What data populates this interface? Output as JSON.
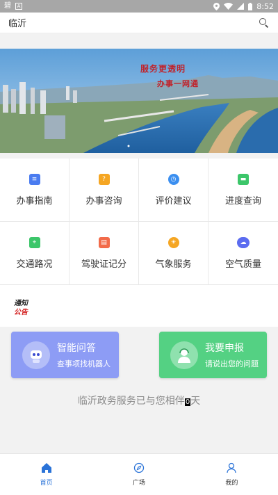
{
  "status_bar": {
    "carrier_icon": "碧",
    "time": "8:52",
    "icons": [
      "location-icon",
      "wifi-icon",
      "signal-icon",
      "battery-icon"
    ]
  },
  "header": {
    "title": "临沂",
    "search_icon": "search-icon"
  },
  "banner": {
    "slogan_line1": "服务更透明",
    "slogan_line2": "办事一网通"
  },
  "services": [
    {
      "label": "办事指南",
      "icon": "guide-icon",
      "color": "#4a7cf0"
    },
    {
      "label": "办事咨询",
      "icon": "consult-icon",
      "color": "#f5a623"
    },
    {
      "label": "评价建议",
      "icon": "clock-icon",
      "color": "#3b8ff0"
    },
    {
      "label": "进度查询",
      "icon": "progress-icon",
      "color": "#3cc66a"
    },
    {
      "label": "交通路况",
      "icon": "traffic-icon",
      "color": "#3cc66a"
    },
    {
      "label": "驾驶证记分",
      "icon": "license-icon",
      "color": "#f26b4a"
    },
    {
      "label": "气象服务",
      "icon": "weather-icon",
      "color": "#f5a623"
    },
    {
      "label": "空气质量",
      "icon": "air-cloud-icon",
      "color": "#5b6cf0"
    }
  ],
  "notice": {
    "line1": "通知",
    "line2": "公告"
  },
  "cards": {
    "qa": {
      "title": "智能问答",
      "subtitle": "查事项找机器人",
      "color": "#8d9cf5"
    },
    "report": {
      "title": "我要申报",
      "subtitle": "请说出您的问题",
      "color": "#54d183"
    }
  },
  "counter": {
    "prefix": "临沂政务服务已与您相伴",
    "days": "0",
    "suffix": "天"
  },
  "tabs": [
    {
      "label": "首页",
      "icon": "home-icon",
      "active": true
    },
    {
      "label": "广场",
      "icon": "compass-icon",
      "active": false
    },
    {
      "label": "我的",
      "icon": "user-icon",
      "active": false
    }
  ],
  "colors": {
    "accent": "#2a73d8",
    "status_bar": "#a7a7a7"
  }
}
